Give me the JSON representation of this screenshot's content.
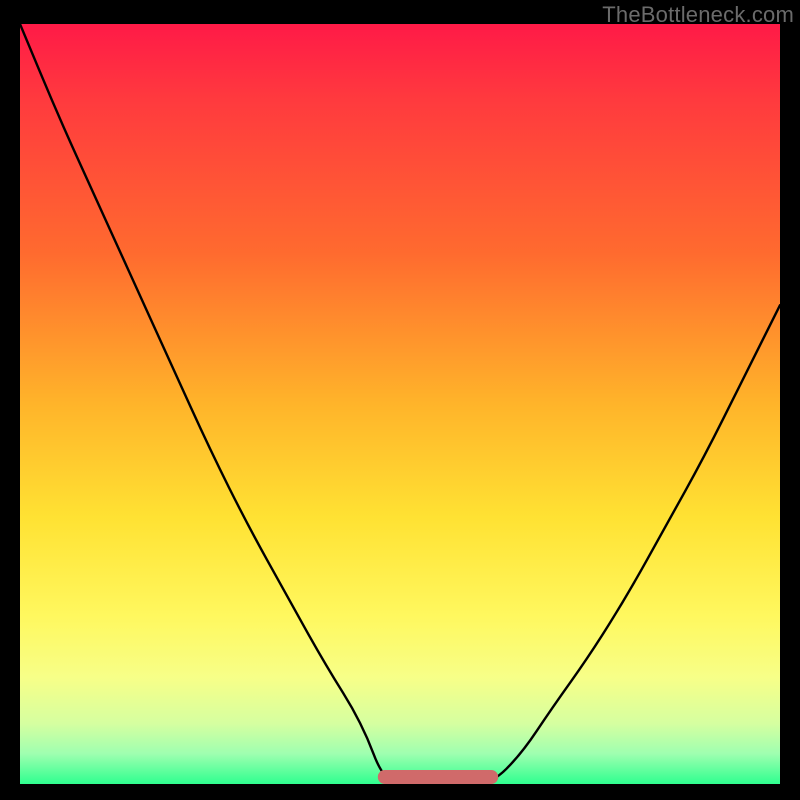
{
  "watermark": {
    "text": "TheBottleneck.com"
  },
  "chart_data": {
    "type": "line",
    "title": "",
    "xlabel": "",
    "ylabel": "",
    "xlim": [
      0,
      100
    ],
    "ylim": [
      0,
      100
    ],
    "series": [
      {
        "name": "curve",
        "x": [
          0,
          5,
          10,
          15,
          20,
          25,
          30,
          35,
          40,
          45,
          48,
          52,
          55,
          58,
          62,
          66,
          70,
          75,
          80,
          85,
          90,
          95,
          100
        ],
        "values": [
          100,
          88,
          77,
          66,
          55,
          44,
          34,
          25,
          16,
          8,
          0,
          0,
          0,
          0,
          0,
          4,
          10,
          17,
          25,
          34,
          43,
          53,
          63
        ]
      }
    ],
    "annotations": [
      {
        "name": "flat-segment",
        "x_range": [
          48,
          62
        ],
        "y": 0,
        "style": "thick-red-rounded"
      }
    ],
    "background": {
      "type": "vertical-gradient",
      "stops": [
        {
          "pos": 0.0,
          "color": "#ff1a47"
        },
        {
          "pos": 0.3,
          "color": "#ff6a2f"
        },
        {
          "pos": 0.65,
          "color": "#ffe233"
        },
        {
          "pos": 0.86,
          "color": "#f7ff88"
        },
        {
          "pos": 1.0,
          "color": "#2fff8f"
        }
      ]
    }
  }
}
